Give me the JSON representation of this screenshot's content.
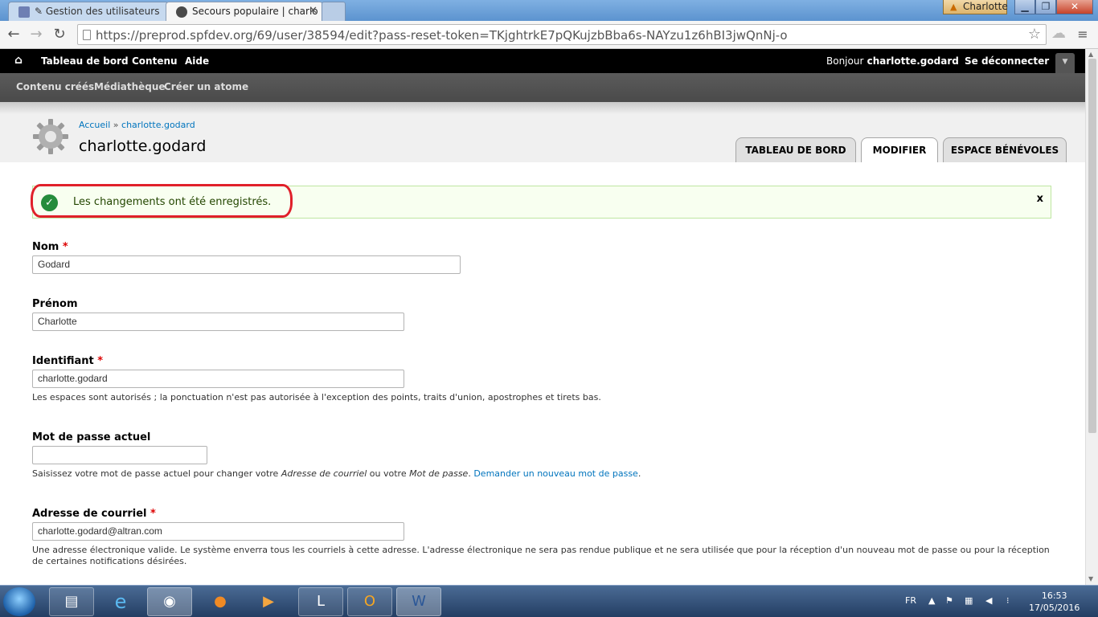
{
  "browser": {
    "tabs": [
      {
        "title": "✎ Gestion des utilisateurs",
        "active": false
      },
      {
        "title": "Secours populaire | charlo",
        "active": true
      }
    ],
    "user_badge": "Charlotte",
    "url": "https://preprod.spfdev.org/69/user/38594/edit?pass-reset-token=TKjghtrkE7pQKujzbBba6s-NAYzu1z6hBI3jwQnNj-o"
  },
  "adminbar": {
    "home_icon": "home-icon",
    "items": [
      "Tableau de bord",
      "Contenu",
      "Aide"
    ],
    "greeting": "Bonjour",
    "username": "charlotte.godard",
    "logout": "Se déconnecter"
  },
  "shortcuts": [
    "Contenu créés",
    "Médiathèque",
    "Créer un atome"
  ],
  "header": {
    "breadcrumb_home": "Accueil",
    "breadcrumb_sep": "»",
    "breadcrumb_current": "charlotte.godard",
    "title": "charlotte.godard",
    "tabs": [
      "TABLEAU DE BORD",
      "MODIFIER",
      "ESPACE BÉNÉVOLES"
    ],
    "active_tab": "MODIFIER"
  },
  "status": {
    "message": "Les changements ont été enregistrés.",
    "close": "x"
  },
  "form": {
    "nom": {
      "label": "Nom",
      "required": "*",
      "value": "Godard"
    },
    "prenom": {
      "label": "Prénom",
      "value": "Charlotte"
    },
    "identifiant": {
      "label": "Identifiant",
      "required": "*",
      "value": "charlotte.godard",
      "description": "Les espaces sont autorisés ; la ponctuation n'est pas autorisée à l'exception des points, traits d'union, apostrophes et tirets bas."
    },
    "password": {
      "label": "Mot de passe actuel",
      "value": "",
      "desc_prefix": "Saisissez votre mot de passe actuel pour changer votre",
      "desc_em1": "Adresse de courriel",
      "desc_mid": "ou votre",
      "desc_em2": "Mot de passe",
      "desc_link": "Demander un nouveau mot de passe"
    },
    "email": {
      "label": "Adresse de courriel",
      "required": "*",
      "value": "charlotte.godard@altran.com",
      "description": "Une adresse électronique valide. Le système enverra tous les courriels à cette adresse. L'adresse électronique ne sera pas rendue publique et ne sera utilisée que pour la réception d'un nouveau mot de passe ou pour la réception de certaines notifications désirées."
    }
  },
  "taskbar": {
    "apps": [
      "folder-icon",
      "internet-explorer-icon",
      "chrome-icon",
      "firefox-icon",
      "media-player-icon",
      "lync-icon",
      "outlook-icon",
      "word-icon"
    ],
    "lang": "FR",
    "time": "16:53",
    "date": "17/05/2016"
  },
  "colors": {
    "link": "#0074bd",
    "status_bg": "#f8fff0",
    "highlight": "#e0202a",
    "adminbar": "#000000"
  }
}
